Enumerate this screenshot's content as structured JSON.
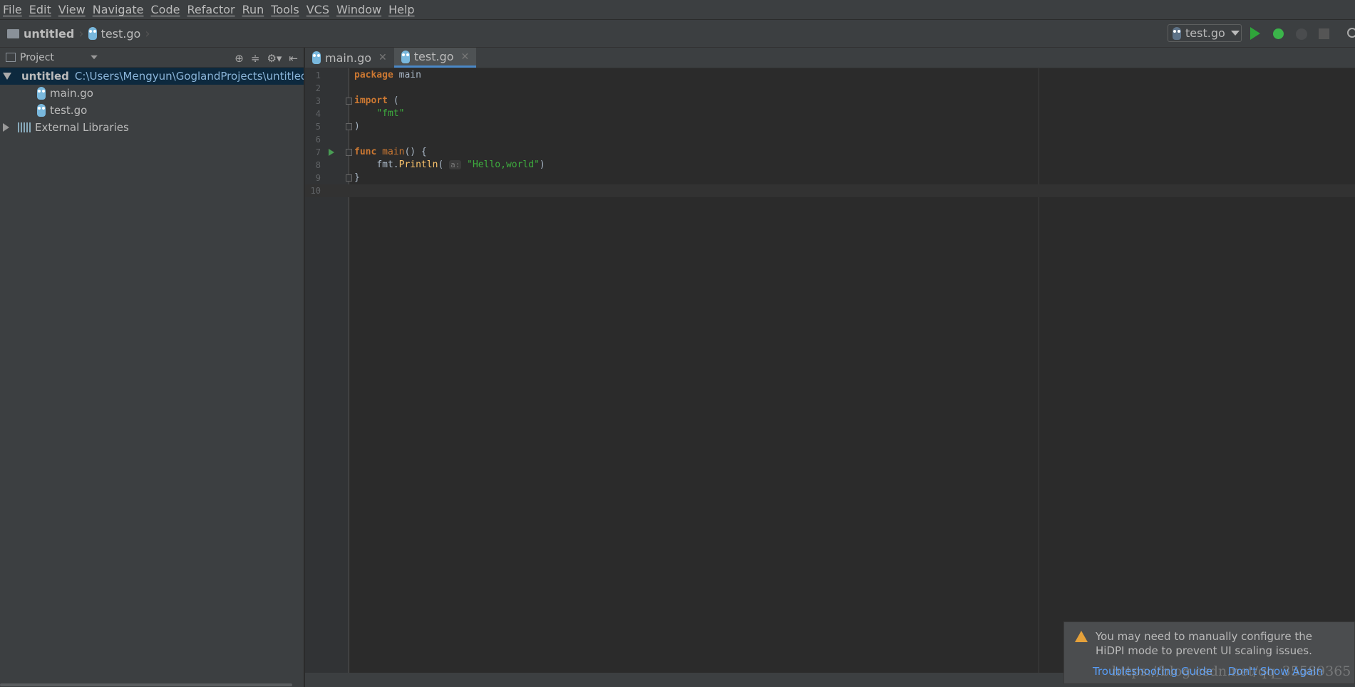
{
  "menu": [
    "File",
    "Edit",
    "View",
    "Navigate",
    "Code",
    "Refactor",
    "Run",
    "Tools",
    "VCS",
    "Window",
    "Help"
  ],
  "breadcrumb": {
    "project": "untitled",
    "file": "test.go"
  },
  "run_config": {
    "label": "test.go"
  },
  "project_panel": {
    "title": "Project",
    "root": {
      "name": "untitled",
      "path": "C:\\Users\\Mengyun\\GoglandProjects\\untitled"
    },
    "files": [
      "main.go",
      "test.go"
    ],
    "libs": "External Libraries"
  },
  "tabs": [
    {
      "label": "main.go",
      "active": false
    },
    {
      "label": "test.go",
      "active": true
    }
  ],
  "code": {
    "line_numbers": [
      "1",
      "2",
      "3",
      "4",
      "5",
      "6",
      "7",
      "8",
      "9",
      "10"
    ],
    "l1_kw": "package",
    "l1_rest": " main",
    "l3_kw": "import",
    "l3_rest": " (",
    "l4": "\"fmt\"",
    "l5": ")",
    "l7_kw": "func",
    "l7_name": "main",
    "l7_rest": "() {",
    "l8_pkg": "fmt.",
    "l8_fn": "Println",
    "l8_open": "(",
    "l8_hint": "a:",
    "l8_str": "\"Hello,world\"",
    "l8_close": ")",
    "l9": "}"
  },
  "notification": {
    "message": "You may need to manually configure the HiDPI mode to prevent UI scaling issues.",
    "link1": "Troubleshooting Guide",
    "link2": "Don't Show Again"
  },
  "watermark": "https://blog.csdn.net/qq_35589365",
  "colors": {
    "keyword": "#cc7832",
    "string": "#3ead3e",
    "function": "#ffc66d",
    "link": "#589df6",
    "selection": "#0d293e",
    "run": "#2fa43a"
  }
}
